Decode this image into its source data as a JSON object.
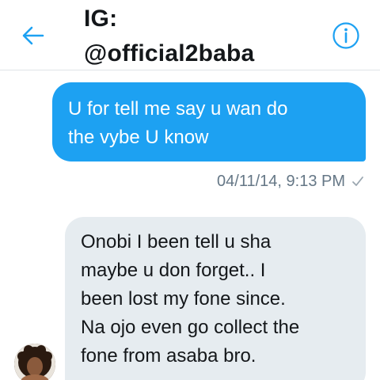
{
  "header": {
    "title": "IG:\n@official2baba",
    "back_icon": "arrow-left-icon",
    "info_icon": "info-circle-icon"
  },
  "conversation": {
    "outgoing": {
      "text": "U for tell me say u wan do\nthe vybe U know",
      "timestamp": "04/11/14, 9:13 PM",
      "status_icon": "checkmark-icon"
    },
    "incoming": {
      "text": "Onobi I been tell u sha\nmaybe u don forget.. I\nbeen lost my fone since.\nNa ojo even go collect the\nfone from asaba bro."
    }
  },
  "colors": {
    "accent": "#1da1f2",
    "incoming_bubble": "#e6ecf0",
    "meta_text": "#657786"
  }
}
